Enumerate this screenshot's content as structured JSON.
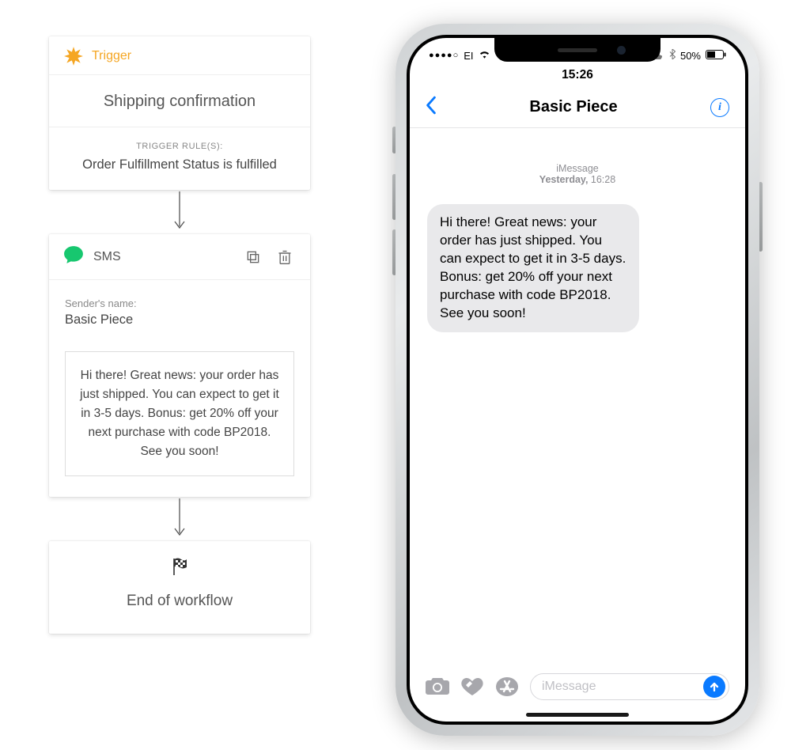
{
  "workflow": {
    "trigger": {
      "label": "Trigger",
      "title": "Shipping confirmation",
      "rules_heading": "TRIGGER RULE(S):",
      "rule": "Order Fulfillment Status is fulfilled"
    },
    "sms": {
      "label": "SMS",
      "sender_label": "Sender's name:",
      "sender_name": "Basic Piece",
      "message": "Hi there! Great news: your order has just shipped. You can expect to get it in 3-5 days. Bonus: get 20% off your next purchase with code BP2018. See you soon!"
    },
    "end": {
      "label": "End of workflow"
    }
  },
  "phone": {
    "status": {
      "signal_label": "●●●●○",
      "carrier": "EI",
      "wifi_icon": "wifi",
      "time": "15:26",
      "battery": "50%"
    },
    "nav": {
      "title": "Basic Piece"
    },
    "thread": {
      "service": "iMessage",
      "when_prefix": "Yesterday,",
      "when_time": "16:28"
    },
    "bubble": "Hi there! Great news: your order has just shipped. You can expect to get it in 3-5 days. Bonus: get 20% off your next purchase with code BP2018. See you soon!",
    "composer": {
      "placeholder": "iMessage"
    }
  }
}
